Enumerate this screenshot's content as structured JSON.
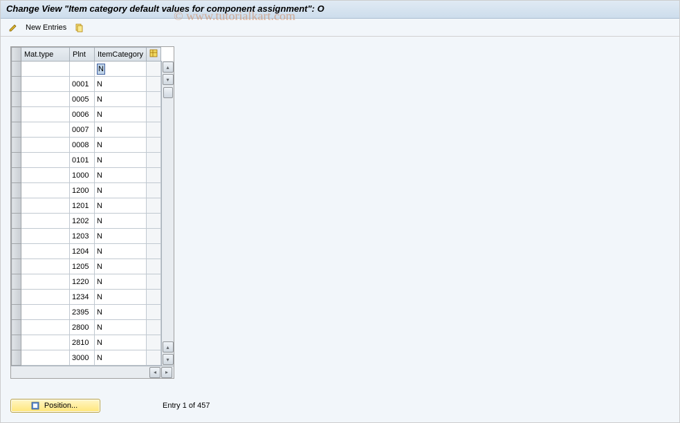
{
  "title": "Change View \"Item category default values for component assignment\": O",
  "watermark": "© www.tutorialkart.com",
  "toolbar": {
    "new_entries_label": "New Entries"
  },
  "table": {
    "headers": {
      "mat_type": "Mat.type",
      "plnt": "Plnt",
      "item_category": "ItemCategory"
    },
    "rows": [
      {
        "mat": "",
        "plnt": "",
        "cat": "N",
        "highlight": true
      },
      {
        "mat": "",
        "plnt": "0001",
        "cat": "N"
      },
      {
        "mat": "",
        "plnt": "0005",
        "cat": "N"
      },
      {
        "mat": "",
        "plnt": "0006",
        "cat": "N"
      },
      {
        "mat": "",
        "plnt": "0007",
        "cat": "N"
      },
      {
        "mat": "",
        "plnt": "0008",
        "cat": "N"
      },
      {
        "mat": "",
        "plnt": "0101",
        "cat": "N"
      },
      {
        "mat": "",
        "plnt": "1000",
        "cat": "N"
      },
      {
        "mat": "",
        "plnt": "1200",
        "cat": "N"
      },
      {
        "mat": "",
        "plnt": "1201",
        "cat": "N"
      },
      {
        "mat": "",
        "plnt": "1202",
        "cat": "N"
      },
      {
        "mat": "",
        "plnt": "1203",
        "cat": "N"
      },
      {
        "mat": "",
        "plnt": "1204",
        "cat": "N"
      },
      {
        "mat": "",
        "plnt": "1205",
        "cat": "N"
      },
      {
        "mat": "",
        "plnt": "1220",
        "cat": "N"
      },
      {
        "mat": "",
        "plnt": "1234",
        "cat": "N"
      },
      {
        "mat": "",
        "plnt": "2395",
        "cat": "N"
      },
      {
        "mat": "",
        "plnt": "2800",
        "cat": "N"
      },
      {
        "mat": "",
        "plnt": "2810",
        "cat": "N"
      },
      {
        "mat": "",
        "plnt": "3000",
        "cat": "N"
      }
    ]
  },
  "footer": {
    "position_label": "Position...",
    "entry_label": "Entry 1 of 457"
  }
}
